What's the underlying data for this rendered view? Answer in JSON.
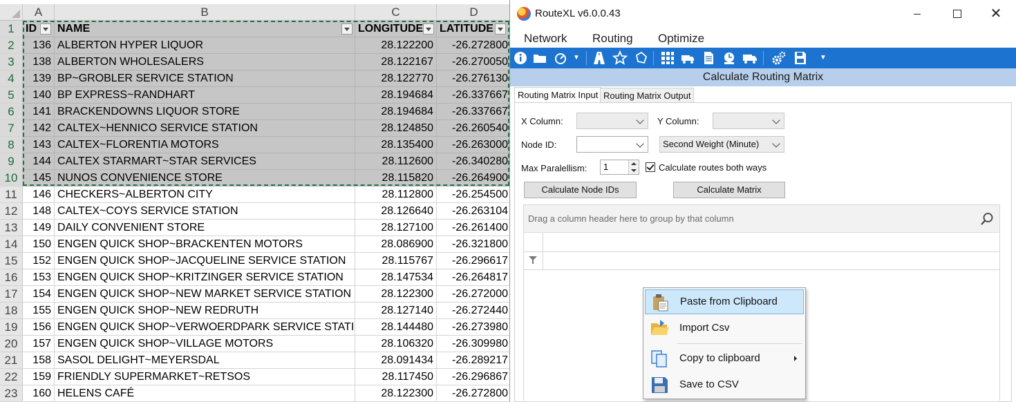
{
  "spreadsheet": {
    "columns": [
      "A",
      "B",
      "C",
      "D"
    ],
    "header": {
      "id": "ID",
      "name": "NAME",
      "longitude": "LONGITUDE",
      "latitude": "LATITUDE"
    },
    "row_numbers": [
      "1",
      "2",
      "3",
      "4",
      "5",
      "6",
      "7",
      "8",
      "9",
      "10",
      "11",
      "12",
      "13",
      "14",
      "15",
      "16",
      "17",
      "18",
      "19",
      "20",
      "21",
      "22",
      "23"
    ],
    "rows": [
      {
        "id": "136",
        "name": "ALBERTON HYPER LIQUOR",
        "lon": "28.122200",
        "lat": "-26.272800"
      },
      {
        "id": "138",
        "name": "ALBERTON WHOLESALERS",
        "lon": "28.122167",
        "lat": "-26.270050"
      },
      {
        "id": "139",
        "name": "BP~GROBLER SERVICE STATION",
        "lon": "28.122770",
        "lat": "-26.276130"
      },
      {
        "id": "140",
        "name": "BP EXPRESS~RANDHART",
        "lon": "28.194684",
        "lat": "-26.337667"
      },
      {
        "id": "141",
        "name": "BRACKENDOWNS LIQUOR STORE",
        "lon": "28.194684",
        "lat": "-26.337667"
      },
      {
        "id": "142",
        "name": "CALTEX~HENNICO SERVICE STATION",
        "lon": "28.124850",
        "lat": "-26.260540"
      },
      {
        "id": "143",
        "name": "CALTEX~FLORENTIA MOTORS",
        "lon": "28.135400",
        "lat": "-26.263000"
      },
      {
        "id": "144",
        "name": "CALTEX STARMART~STAR SERVICES",
        "lon": "28.112600",
        "lat": "-26.340280"
      },
      {
        "id": "145",
        "name": "NUNOS CONVENIENCE STORE",
        "lon": "28.115820",
        "lat": "-26.264900"
      },
      {
        "id": "146",
        "name": "CHECKERS~ALBERTON CITY",
        "lon": "28.112800",
        "lat": "-26.254500"
      },
      {
        "id": "148",
        "name": "CALTEX~COYS SERVICE STATION",
        "lon": "28.126640",
        "lat": "-26.263104"
      },
      {
        "id": "149",
        "name": "DAILY CONVENIENT STORE",
        "lon": "28.127100",
        "lat": "-26.261400"
      },
      {
        "id": "150",
        "name": "ENGEN QUICK SHOP~BRACKENTEN MOTORS",
        "lon": "28.086900",
        "lat": "-26.321800"
      },
      {
        "id": "152",
        "name": "ENGEN QUICK SHOP~JACQUELINE SERVICE STATION",
        "lon": "28.115767",
        "lat": "-26.296617"
      },
      {
        "id": "153",
        "name": "ENGEN QUICK SHOP~KRITZINGER SERVICE STATION",
        "lon": "28.147534",
        "lat": "-26.264817"
      },
      {
        "id": "154",
        "name": "ENGEN QUICK SHOP~NEW MARKET SERVICE STATION",
        "lon": "28.122300",
        "lat": "-26.272000"
      },
      {
        "id": "155",
        "name": "ENGEN QUICK SHOP~NEW REDRUTH",
        "lon": "28.127140",
        "lat": "-26.272440"
      },
      {
        "id": "156",
        "name": "ENGEN QUICK SHOP~VERWOERDPARK SERVICE STATION",
        "lon": "28.144480",
        "lat": "-26.273980"
      },
      {
        "id": "157",
        "name": "ENGEN QUICK SHOP~VILLAGE MOTORS",
        "lon": "28.106320",
        "lat": "-26.309980"
      },
      {
        "id": "158",
        "name": "SASOL DELIGHT~MEYERSDAL",
        "lon": "28.091434",
        "lat": "-26.289217"
      },
      {
        "id": "159",
        "name": "FRIENDLY SUPERMARKET~RETSOS",
        "lon": "28.117450",
        "lat": "-26.296867"
      },
      {
        "id": "160",
        "name": "HELENS CAFÉ",
        "lon": "28.122300",
        "lat": "-26.272800"
      }
    ]
  },
  "window": {
    "title": "RouteXL v6.0.0.43",
    "close_glyph": "✕",
    "menu": {
      "network": "Network",
      "routing": "Routing",
      "optimize": "Optimize"
    },
    "panel_title": "Calculate Routing Matrix",
    "tabs": {
      "input": "Routing Matrix Input",
      "output": "Routing Matrix Output"
    },
    "form": {
      "x_column_label": "X Column:",
      "y_column_label": "Y Column:",
      "node_id_label": "Node ID:",
      "weight_value": "Second Weight (Minute)",
      "max_parallelism_label": "Max Paralellism:",
      "max_parallelism_value": "1",
      "calc_both_label": "Calculate routes both ways",
      "calc_node_ids_button": "Calculate Node IDs",
      "calc_matrix_button": "Calculate Matrix"
    },
    "grid": {
      "group_hint": "Drag a column header here to group by that column"
    }
  },
  "context_menu": {
    "paste": "Paste from Clipboard",
    "import": "Import Csv",
    "copy": "Copy to clipboard",
    "save": "Save to CSV"
  },
  "colors": {
    "accent": "#1d74d0",
    "panel_header": "#b8cfec",
    "selection": "#c6c6c6",
    "marquee": "#217346"
  }
}
